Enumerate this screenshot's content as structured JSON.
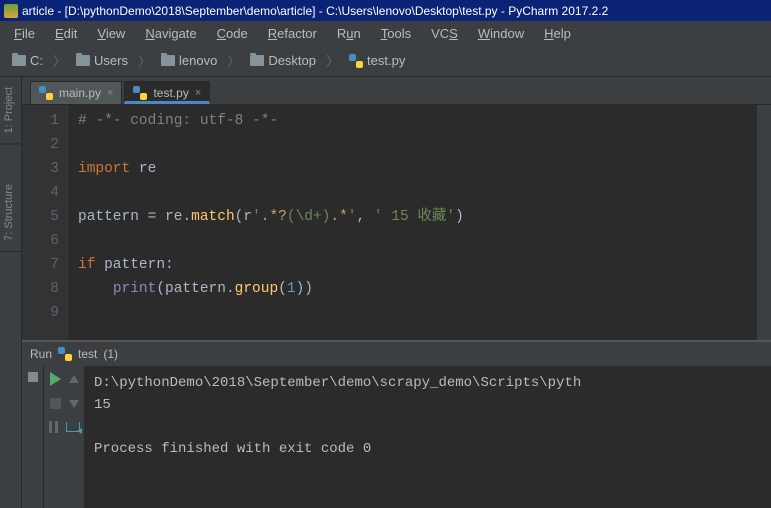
{
  "title": "article - [D:\\pythonDemo\\2018\\September\\demo\\article] - C:\\Users\\lenovo\\Desktop\\test.py - PyCharm 2017.2.2",
  "menu": {
    "file": "File",
    "edit": "Edit",
    "view": "View",
    "navigate": "Navigate",
    "code": "Code",
    "refactor": "Refactor",
    "run": "Run",
    "tools": "Tools",
    "vcs": "VCS",
    "window": "Window",
    "help": "Help"
  },
  "breadcrumb": [
    {
      "label": "C:",
      "kind": "drive"
    },
    {
      "label": "Users",
      "kind": "folder"
    },
    {
      "label": "lenovo",
      "kind": "folder"
    },
    {
      "label": "Desktop",
      "kind": "folder"
    },
    {
      "label": "test.py",
      "kind": "pyfile"
    }
  ],
  "side_tools": {
    "project": "1: Project",
    "structure": "7: Structure"
  },
  "tabs": [
    {
      "label": "main.py",
      "active": false
    },
    {
      "label": "test.py",
      "active": true
    }
  ],
  "code": {
    "lines": [
      "1",
      "2",
      "3",
      "4",
      "5",
      "6",
      "7",
      "8",
      "9"
    ],
    "l1_comment": "# -*- coding: utf-8 -*-",
    "l3_import": "import",
    "l3_mod": " re",
    "l5_pattern": "pattern ",
    "l5_eq": "= ",
    "l5_re": "re",
    "l5_dot1": ".",
    "l5_match": "match",
    "l5_open": "(",
    "l5_r": "r",
    "l5_q1": "'",
    "l5_reg_a": ".*?",
    "l5_reg_b": "(\\d+)",
    "l5_reg_c": ".*",
    "l5_q2": "'",
    "l5_comma": ", ",
    "l5_s2": "' 15 收藏'",
    "l5_close": ")",
    "l7_if": "if",
    "l7_cond": " pattern:",
    "l8_indent": "    ",
    "l8_print": "print",
    "l8_open": "(",
    "l8_pat": "pattern",
    "l8_dot": ".",
    "l8_group": "group",
    "l8_p1": "(",
    "l8_one": "1",
    "l8_p2": "))"
  },
  "run": {
    "header_label": "Run",
    "config_name": "test",
    "config_count": "(1)",
    "output_line1": "D:\\pythonDemo\\2018\\September\\demo\\scrapy_demo\\Scripts\\pyth",
    "output_line2": "15",
    "output_line3": "",
    "output_line4": "Process finished with exit code 0"
  }
}
